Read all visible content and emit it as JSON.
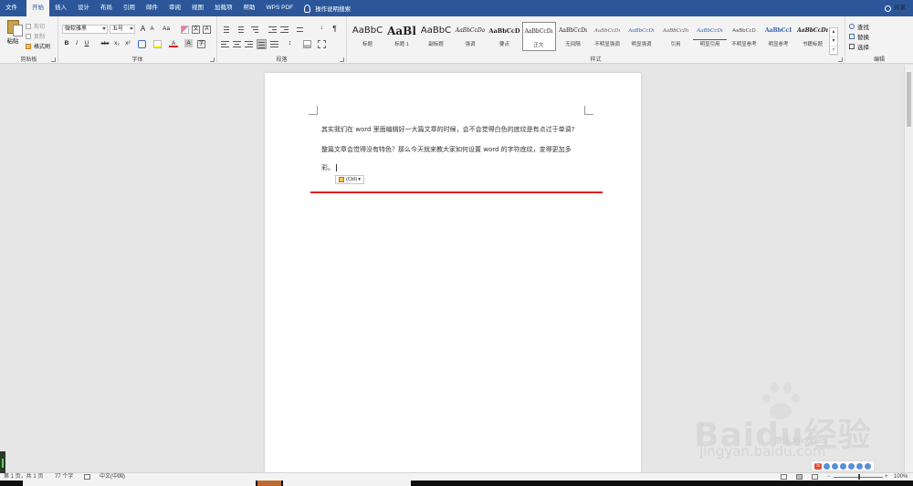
{
  "ribbon_tabs": [
    "文件",
    "开始",
    "插入",
    "设计",
    "布局",
    "引用",
    "邮件",
    "审阅",
    "视图",
    "加载项",
    "帮助",
    "WPS PDF"
  ],
  "active_tab": "开始",
  "tell_me": "操作说明搜索",
  "share": "共享",
  "clipboard": {
    "paste": "粘贴",
    "cut": "剪切",
    "copy": "复制",
    "format_painter": "格式刷",
    "group_label": "剪贴板"
  },
  "font": {
    "name": "微软雅黑",
    "size": "五号",
    "grow": "A",
    "shrink": "A",
    "case": "Aa",
    "bold": "B",
    "italic": "I",
    "underline": "U",
    "strike": "abc",
    "subscript": "x₂",
    "superscript": "x²",
    "font_color": "A",
    "char_shading": "A",
    "group_label": "字体"
  },
  "paragraph": {
    "group_label": "段落"
  },
  "styles": {
    "items": [
      {
        "sample": "AaBbC",
        "name": "标题"
      },
      {
        "sample": "AaBl",
        "name": "标题 1"
      },
      {
        "sample": "AaBbC",
        "name": "副标题"
      },
      {
        "sample": "AaBbCcDa",
        "name": "强调"
      },
      {
        "sample": "AaBbCcD",
        "name": "要点"
      },
      {
        "sample": "AaBbCcDı",
        "name": "正文"
      },
      {
        "sample": "AaBbCcDı",
        "name": "无间隔"
      },
      {
        "sample": "AaBbCcDı",
        "name": "不明显强调"
      },
      {
        "sample": "AaBbCcDı",
        "name": "明显强调"
      },
      {
        "sample": "AaBbCcDı",
        "name": "引用"
      },
      {
        "sample": "AaBbCcDı",
        "name": "明显引用"
      },
      {
        "sample": "AaBbCcD",
        "name": "不明显参考"
      },
      {
        "sample": "AaBbCcI",
        "name": "明显参考"
      },
      {
        "sample": "AaBbCcDı",
        "name": "书籍标题"
      }
    ],
    "selected": "正文",
    "group_label": "样式"
  },
  "editing": {
    "find": "查找",
    "replace": "替换",
    "select": "选择",
    "group_label": "编辑"
  },
  "document": {
    "line1": "其实我们在 word 里面编辑好一大篇文章的时候，会不会觉得白色的底纹是有点过于单调?",
    "line2": "整篇文章会觉得没有特色？那么今天就来教大家如何设置  word  的字符底纹，变得更加多",
    "line3": "彩。",
    "paste_options": "(Ctrl)"
  },
  "status": {
    "page": "第 1 页，共 1 页",
    "words": "77 个字",
    "language": "中文(中国)",
    "zoom": "100%"
  },
  "watermark": {
    "brand": "Baidu经验",
    "url": "jingyan.baidu.com",
    "activate": "激活 Windows"
  },
  "colors": {
    "ribbon_blue": "#2b579a",
    "rule_red": "#e02020"
  }
}
